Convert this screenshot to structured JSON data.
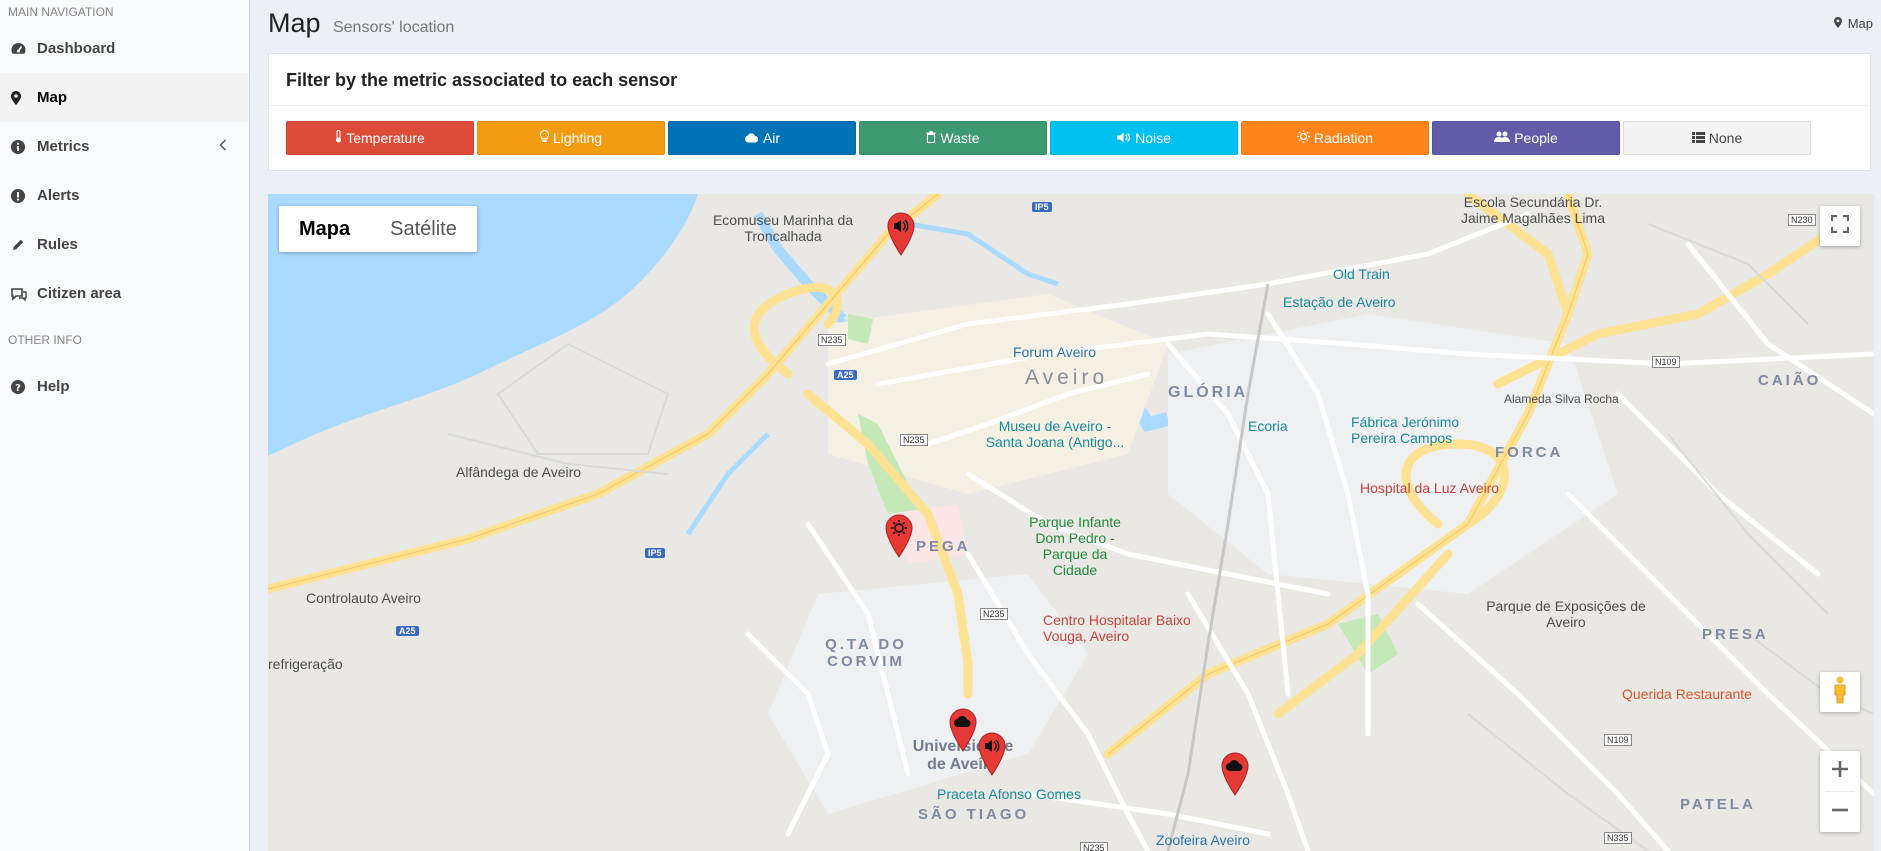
{
  "sidebar": {
    "main_header": "MAIN NAVIGATION",
    "other_header": "OTHER INFO",
    "items": [
      {
        "label": "Dashboard",
        "icon": "dashboard-icon"
      },
      {
        "label": "Map",
        "icon": "map-marker-icon"
      },
      {
        "label": "Metrics",
        "icon": "info-circle-icon"
      },
      {
        "label": "Alerts",
        "icon": "exclamation-circle-icon"
      },
      {
        "label": "Rules",
        "icon": "pencil-icon"
      },
      {
        "label": "Citizen area",
        "icon": "comments-icon"
      }
    ],
    "help": {
      "label": "Help",
      "icon": "question-circle-icon"
    }
  },
  "header": {
    "title": "Map",
    "subtitle": "Sensors' location",
    "breadcrumb": "Map"
  },
  "filter": {
    "title": "Filter by the metric associated to each sensor",
    "buttons": [
      {
        "label": "Temperature",
        "color": "#dd4b39",
        "icon": "thermometer-icon"
      },
      {
        "label": "Lighting",
        "color": "#f39c12",
        "icon": "lightbulb-icon"
      },
      {
        "label": "Air",
        "color": "#0073b7",
        "icon": "cloud-icon"
      },
      {
        "label": "Waste",
        "color": "#3d9970",
        "icon": "trash-icon"
      },
      {
        "label": "Noise",
        "color": "#00c0ef",
        "icon": "volume-icon"
      },
      {
        "label": "Radiation",
        "color": "#ff851b",
        "icon": "sun-icon"
      },
      {
        "label": "People",
        "color": "#605ca8",
        "icon": "users-icon"
      },
      {
        "label": "None",
        "color": "#f4f4f4",
        "icon": "list-icon"
      }
    ]
  },
  "map": {
    "type_controls": {
      "map": "Mapa",
      "satellite": "Satélite"
    },
    "labels": {
      "ecomuseu": "Ecomuseu Marinha da Troncalhada",
      "old_train": "Old Train",
      "estacao": "Estação de Aveiro",
      "forum": "Forum Aveiro",
      "aveiro": "Aveiro",
      "gloria": "GLÓRIA",
      "museu": "Museu de Aveiro - Santa Joana (Antigo...",
      "ecoria": "Ecoria",
      "fabrica": "Fábrica Jerónimo Pereira Campos",
      "forca": "FORCA",
      "hospital_luz": "Hospital da Luz Aveiro",
      "alfandega": "Alfândega de Aveiro",
      "pega": "PEGA",
      "parque_infante": "Parque Infante Dom Pedro - Parque da Cidade",
      "controlauto": "Controlauto Aveiro",
      "centro_hosp": "Centro Hospitalar Baixo Vouga, Aveiro",
      "corvim": "Q.TA DO CORVIM",
      "refrig": "refrigeração",
      "universidade": "Universidade de Aveiro",
      "praceta": "Praceta Afonso Gomes",
      "sao_tiago": "SÃO TIAGO",
      "zoofeira": "Zoofeira Aveiro",
      "parque_exp": "Parque de Exposições de Aveiro",
      "presa": "PRESA",
      "querida": "Querida Restaurante",
      "patela": "PATELA",
      "caiao": "CAIÃO",
      "alameda": "Alameda Silva Rocha",
      "escola": "Escola Secundária Dr. Jaime Magalhães Lima"
    },
    "markers": [
      {
        "type": "noise",
        "icon": "volume-icon"
      },
      {
        "type": "radiation",
        "icon": "sun-icon"
      },
      {
        "type": "air",
        "icon": "cloud-icon"
      },
      {
        "type": "noise",
        "icon": "volume-icon"
      },
      {
        "type": "air",
        "icon": "cloud-icon"
      }
    ]
  }
}
